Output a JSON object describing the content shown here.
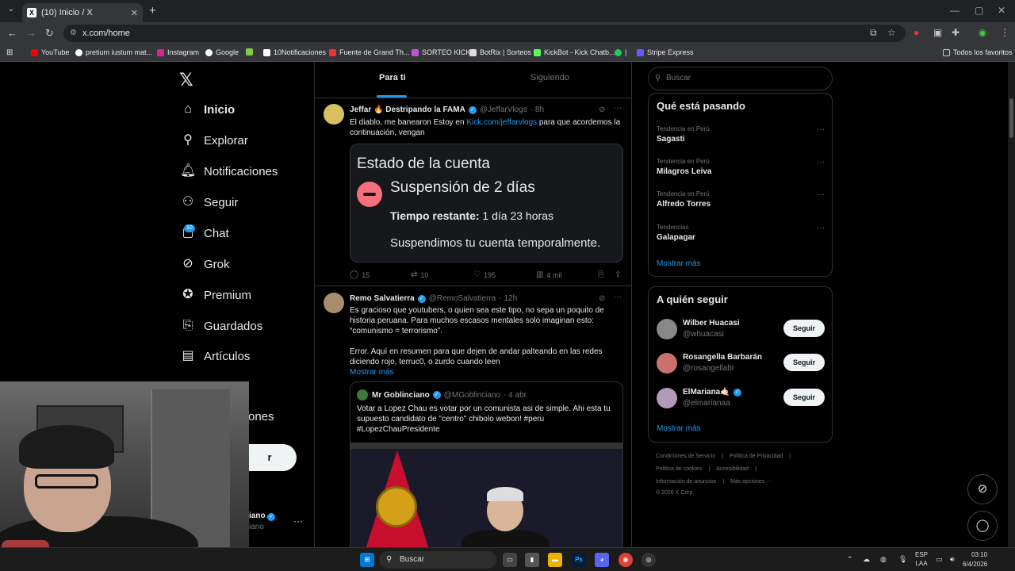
{
  "browser": {
    "tab_title": "(10) Inicio / X",
    "url": "x.com/home",
    "bookmarks": [
      "YouTube",
      "pretium iustum mat...",
      "Instagram",
      "Google",
      "10Notificaciones",
      "Fuente de Grand Th...",
      "SORTEO KICK",
      "BotRix | Sorteos",
      "KickBot - Kick Chatb...",
      "|",
      "Stripe Express"
    ],
    "all_bookmarks": "Todos los favoritos"
  },
  "nav": {
    "items": [
      "Inicio",
      "Explorar",
      "Notificaciones",
      "Seguir",
      "Chat",
      "Grok",
      "Premium",
      "Guardados",
      "Artículos"
    ],
    "partial_item": "ones",
    "chat_badge": "10",
    "post_button": "r",
    "account_name": "iano",
    "account_handle": "iano"
  },
  "feed": {
    "tabs": [
      "Para ti",
      "Siguiendo"
    ],
    "post1": {
      "name": "Jeffar 🔥 Destripando la FAMA",
      "handle": "@JeffarVlogs",
      "time": "· 8h",
      "text_before": "El diablo, me banearon  Estoy en ",
      "link": "Kick.com/jeffarvlogs",
      "text_after": " para que acordemos la continuación, vengan",
      "card_title": "Estado de la cuenta",
      "card_sub": "Suspensión de 2 días",
      "card_time_label": "Tiempo restante:",
      "card_time_value": " 1 día 23 horas",
      "card_note": "Suspendimos tu cuenta temporalmente.",
      "replies": "15",
      "reposts": "10",
      "likes": "195",
      "views": "4 mil"
    },
    "post2": {
      "name": "Remo Salvatierra",
      "handle": "@RemoSalvatierra",
      "time": "· 12h",
      "text1": "Es gracioso que youtubers, o quien sea este tipo, no sepa un poquito de historia peruana. Para muchos escasos mentales solo imaginan esto: “comunismo = terrorismo”.",
      "text2": "Error. Aquí en resumen para que dejen de andar palteando en las redes diciendo rojo, terruc0, o zurdo cuando leen",
      "show_more": "Mostrar más",
      "quote_name": "Mr Goblinciano",
      "quote_handle": "@MGoblinciano",
      "quote_time": "· 4 abr.",
      "quote_text": "Votar a Lopez Chau es votar por un comunista asi de simple. Ahi esta tu supuesto candidato de \"centro\" chibolo webon! #peru #LopezChauPresidente"
    }
  },
  "right": {
    "search_placeholder": "Buscar",
    "trends_title": "Qué está pasando",
    "trends": [
      {
        "context": "Tendencia en Perú",
        "name": "Sagasti"
      },
      {
        "context": "Tendencia en Perú",
        "name": "Milagros Leiva"
      },
      {
        "context": "Tendencia en Perú",
        "name": "Alfredo Torres"
      },
      {
        "context": "Tendencias",
        "name": "Galapagar"
      }
    ],
    "show_more": "Mostrar más",
    "follow_title": "A quién seguir",
    "follow": [
      {
        "name": "Wilber Huacasi",
        "handle": "@whuacasi",
        "button": "Seguir"
      },
      {
        "name": "Rosangella Barbarán",
        "handle": "@rosangellabr",
        "button": "Seguir"
      },
      {
        "name": "ElMariana🤙🏻",
        "handle": "@elmarianaa",
        "button": "Seguir"
      }
    ],
    "footer_line1": [
      "Condiciones de Servicio",
      "|",
      "Política de Privacidad",
      "|"
    ],
    "footer_line2": [
      "Política de cookies",
      "|",
      "Accesibilidad",
      "|"
    ],
    "footer_line3": [
      "Información de anuncios",
      "|",
      "Más opciones ···"
    ],
    "footer_line4": "© 2026 X Corp."
  },
  "taskbar": {
    "search": "Buscar",
    "lang1": "ESP",
    "lang2": "LAA",
    "time": "03:10",
    "date": "6/4/2026"
  },
  "colors": {
    "accent": "#1d9bf0",
    "background": "#000000",
    "text": "#e7e9ea",
    "muted": "#71767b"
  }
}
